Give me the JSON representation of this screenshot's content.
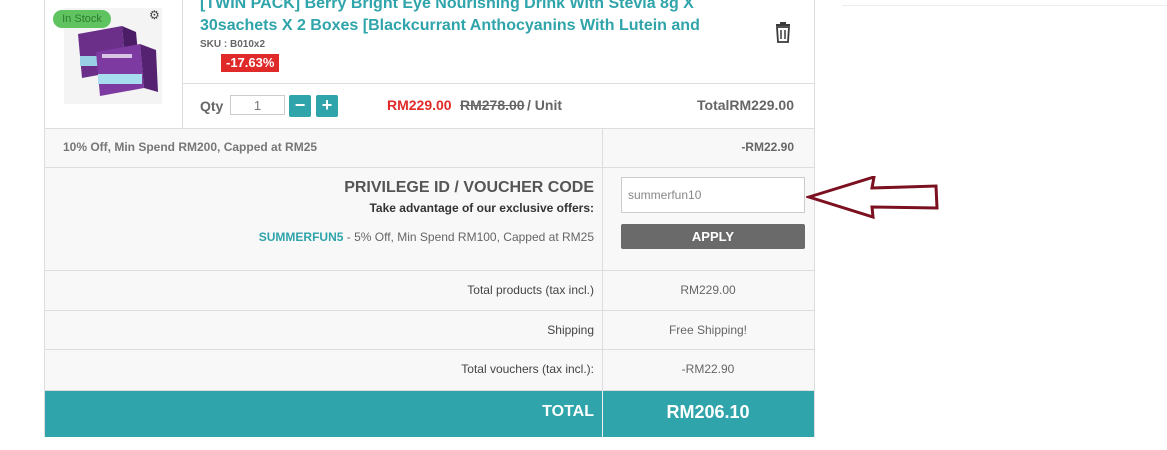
{
  "product": {
    "stock_badge": "In Stock",
    "title": "[TWIN PACK] Berry Bright Eye Nourishing Drink With Stevia 8g X 30sachets X 2 Boxes [Blackcurrant Anthocyanins With Lutein and",
    "sku": "SKU : B010x2",
    "discount_badge": "-17.63%",
    "image_icon": "product-box-image",
    "settings_icon": "gear-icon",
    "delete_icon": "trash-icon"
  },
  "quantity": {
    "label": "Qty",
    "value": "1",
    "minus": "−",
    "plus": "+"
  },
  "pricing": {
    "price_now": "RM229.00",
    "price_old": "RM278.00",
    "per_unit": "/ Unit",
    "line_total": "TotalRM229.00"
  },
  "applied_discount": {
    "text": "10% Off, Min Spend RM200, Capped at RM25",
    "amount": "-RM22.90"
  },
  "voucher": {
    "title": "PRIVILEGE ID / VOUCHER CODE",
    "subtitle": "Take advantage of our exclusive offers:",
    "offer_code": "SUMMERFUN5",
    "offer_text": " - 5% Off, Min Spend RM100, Capped at RM25",
    "input_value": "summerfun10",
    "apply_label": "APPLY"
  },
  "summary": {
    "rows": [
      {
        "label": "Total products (tax incl.)",
        "value": "RM229.00"
      },
      {
        "label": "Shipping",
        "value": "Free Shipping!"
      },
      {
        "label": "Total vouchers (tax incl.):",
        "value": "-RM22.90"
      }
    ],
    "total_label": "TOTAL",
    "total_value": "RM206.10"
  },
  "colors": {
    "accent": "#2fa4aa",
    "discount_red": "#e02a2a",
    "in_stock_green": "#5fc45f",
    "annotation_arrow": "#7b1020"
  }
}
